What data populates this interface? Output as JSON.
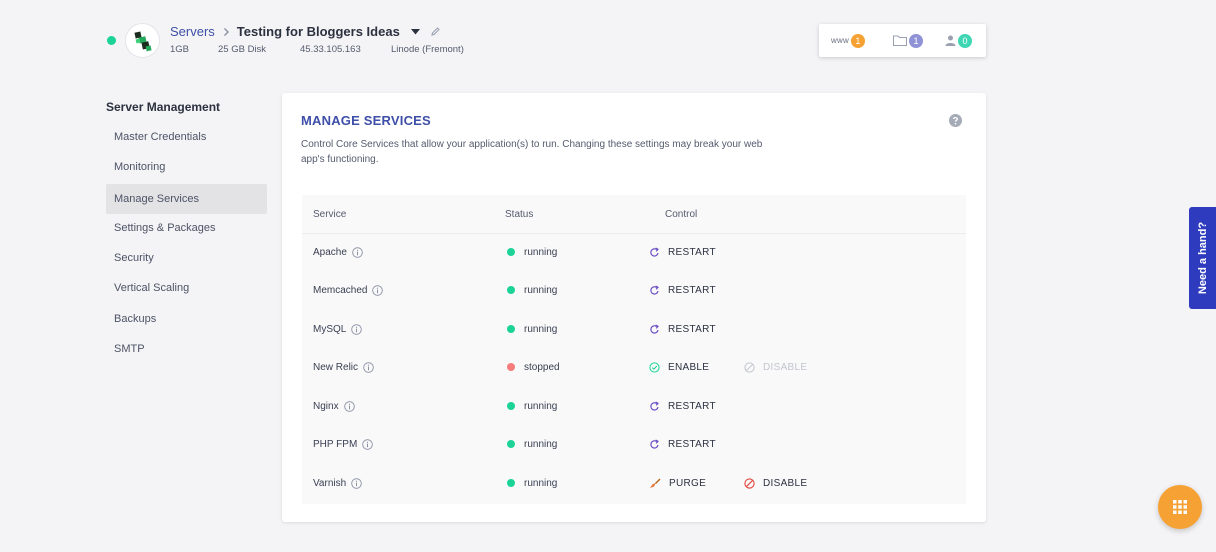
{
  "header": {
    "breadcrumb_root": "Servers",
    "server_name": "Testing for Bloggers Ideas",
    "meta": {
      "ram": "1GB",
      "disk": "25 GB Disk",
      "ip": "45.33.105.163",
      "provider": "Linode (Fremont)"
    },
    "stats": {
      "www_label": "www",
      "www_count": "1",
      "files_count": "1",
      "users_count": "0"
    }
  },
  "sidebar": {
    "heading": "Server Management",
    "items": [
      "Master Credentials",
      "Monitoring",
      "Manage Services",
      "Settings & Packages",
      "Security",
      "Vertical Scaling",
      "Backups",
      "SMTP"
    ]
  },
  "card": {
    "title": "MANAGE SERVICES",
    "description": "Control Core Services that allow your application(s) to run. Changing these settings may break your web app's functioning.",
    "columns": {
      "service": "Service",
      "status": "Status",
      "control": "Control"
    },
    "rows": [
      {
        "name": "Apache",
        "status": "running",
        "action1": "RESTART",
        "action2": ""
      },
      {
        "name": "Memcached",
        "status": "running",
        "action1": "RESTART",
        "action2": ""
      },
      {
        "name": "MySQL",
        "status": "running",
        "action1": "RESTART",
        "action2": ""
      },
      {
        "name": "New Relic",
        "status": "stopped",
        "action1": "ENABLE",
        "action2": "DISABLE"
      },
      {
        "name": "Nginx",
        "status": "running",
        "action1": "RESTART",
        "action2": ""
      },
      {
        "name": "PHP FPM",
        "status": "running",
        "action1": "RESTART",
        "action2": ""
      },
      {
        "name": "Varnish",
        "status": "running",
        "action1": "PURGE",
        "action2": "DISABLE"
      }
    ]
  },
  "help_tab": "Need a hand?",
  "colors": {
    "running": "#1bd396",
    "stopped": "#f47c7c",
    "accent": "#3d4fa8",
    "www_badge": "#f5a133",
    "files_badge": "#8f93d6",
    "users_badge": "#3fd6b4"
  },
  "icons": {
    "restart": "restart-icon",
    "enable": "check-circle-icon",
    "disable": "ban-icon",
    "purge": "broom-icon",
    "info": "info-icon",
    "help": "question-icon",
    "apps": "grid-icon"
  }
}
